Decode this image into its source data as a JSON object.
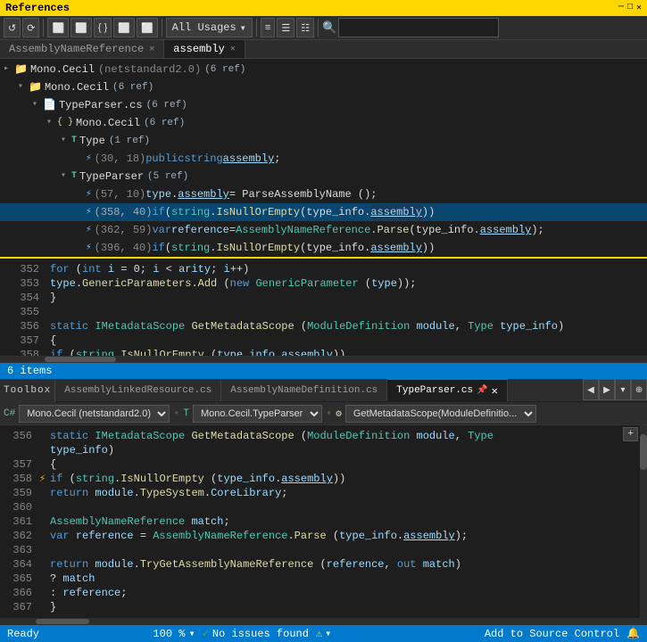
{
  "titleBar": {
    "label": "References"
  },
  "toolbar": {
    "buttons": [
      "↺",
      "⟳",
      "⬜",
      "⬜",
      "{ }",
      "⬜",
      "⬜"
    ],
    "dropdown": "All Usages",
    "layoutBtns": [
      "≡≡",
      "☰",
      "☰"
    ],
    "searchPlaceholder": ""
  },
  "tabs": [
    {
      "label": "AssemblyNameReference",
      "active": false,
      "closeable": true
    },
    {
      "label": "assembly",
      "active": true,
      "closeable": true
    }
  ],
  "referencesTree": {
    "items": [
      {
        "depth": 0,
        "arrow": "▸",
        "icon": "📁",
        "label": "Mono.Cecil",
        "meta": "(netstandard2.0)",
        "count": "(6 ref)"
      },
      {
        "depth": 1,
        "arrow": "▾",
        "icon": "📁",
        "label": "Mono.Cecil",
        "count": "(6 ref)"
      },
      {
        "depth": 2,
        "arrow": "▾",
        "icon": "📄",
        "label": "TypeParser.cs",
        "count": "(6 ref)"
      },
      {
        "depth": 3,
        "arrow": "▾",
        "icon": "{ }",
        "label": "Mono.Cecil",
        "count": "(6 ref)"
      },
      {
        "depth": 4,
        "arrow": "▾",
        "icon": "T",
        "label": "Type",
        "count": "(1 ref)"
      },
      {
        "depth": 5,
        "arrow": "",
        "icon": "⚡",
        "label": "(30, 18) public string assembly;"
      },
      {
        "depth": 4,
        "arrow": "▾",
        "icon": "T",
        "label": "TypeParser",
        "count": "(5 ref)"
      },
      {
        "depth": 5,
        "arrow": "",
        "icon": "⚡",
        "label": "(57, 10) type.assembly = ParseAssemblyName ();"
      },
      {
        "depth": 5,
        "arrow": "",
        "icon": "⚡",
        "label": "(358, 40) if (string.IsNullOrEmpty (type_info.assembly))",
        "selected": true
      },
      {
        "depth": 5,
        "arrow": "",
        "icon": "⚡",
        "label": "(362, 59) var reference = AssemblyNameReference.Parse (type_info.assembly);"
      },
      {
        "depth": 5,
        "arrow": "",
        "icon": "⚡",
        "label": "(396, 40) if (string.IsNullOrEmpty (type_info.assembly))"
      }
    ]
  },
  "codeLines": [
    {
      "num": "352",
      "code": "    for (int i = 0; i < arity; i++)"
    },
    {
      "num": "353",
      "code": "        type.GenericParameters.Add (new GenericParameter (type));"
    },
    {
      "num": "354",
      "code": "    }"
    },
    {
      "num": "355",
      "code": ""
    },
    {
      "num": "356",
      "code": "    static IMetadataScope GetMetadataScope (ModuleDefinition module, Type type_info)"
    },
    {
      "num": "357",
      "code": "    {"
    },
    {
      "num": "358",
      "code": "        if (string.IsNullOrEmpty (type_info.assembly))"
    }
  ],
  "statusItems": "6 items",
  "editorTabs": [
    {
      "label": "AssemblyLinkedResource.cs",
      "active": false
    },
    {
      "label": "AssemblyNameDefinition.cs",
      "active": false
    },
    {
      "label": "TypeParser.cs",
      "active": true,
      "modified": false,
      "closeable": true
    }
  ],
  "editorDropdowns": [
    "Mono.Cecil (netstandard2.0)",
    "Mono.Cecil.TypeParser",
    "GetMetadataScope(ModuleDefinitio..."
  ],
  "editorLines": [
    {
      "num": "356",
      "gutter": "",
      "code": "    static IMetadataScope GetMetadataScope (ModuleDefinition module, Type"
    },
    {
      "num": "",
      "gutter": "",
      "code": "        type_info)"
    },
    {
      "num": "357",
      "gutter": "",
      "code": "    {"
    },
    {
      "num": "358",
      "gutter": "⚡",
      "code": "        if (string.IsNullOrEmpty (type_info.assembly))"
    },
    {
      "num": "359",
      "gutter": "",
      "code": "            return module.TypeSystem.CoreLibrary;"
    },
    {
      "num": "360",
      "gutter": "",
      "code": ""
    },
    {
      "num": "361",
      "gutter": "",
      "code": "        AssemblyNameReference match;"
    },
    {
      "num": "362",
      "gutter": "",
      "code": "        var reference = AssemblyNameReference.Parse (type_info.assembly);"
    },
    {
      "num": "363",
      "gutter": "",
      "code": ""
    },
    {
      "num": "364",
      "gutter": "",
      "code": "        return module.TryGetAssemblyNameReference (reference, out match)"
    },
    {
      "num": "365",
      "gutter": "",
      "code": "            ? match"
    },
    {
      "num": "366",
      "gutter": "",
      "code": "            : reference;"
    },
    {
      "num": "367",
      "gutter": "",
      "code": "    }"
    }
  ],
  "zoom": "100 %",
  "statusRight": "Add to Source Control",
  "noIssues": "No issues found",
  "readyLabel": "Ready"
}
